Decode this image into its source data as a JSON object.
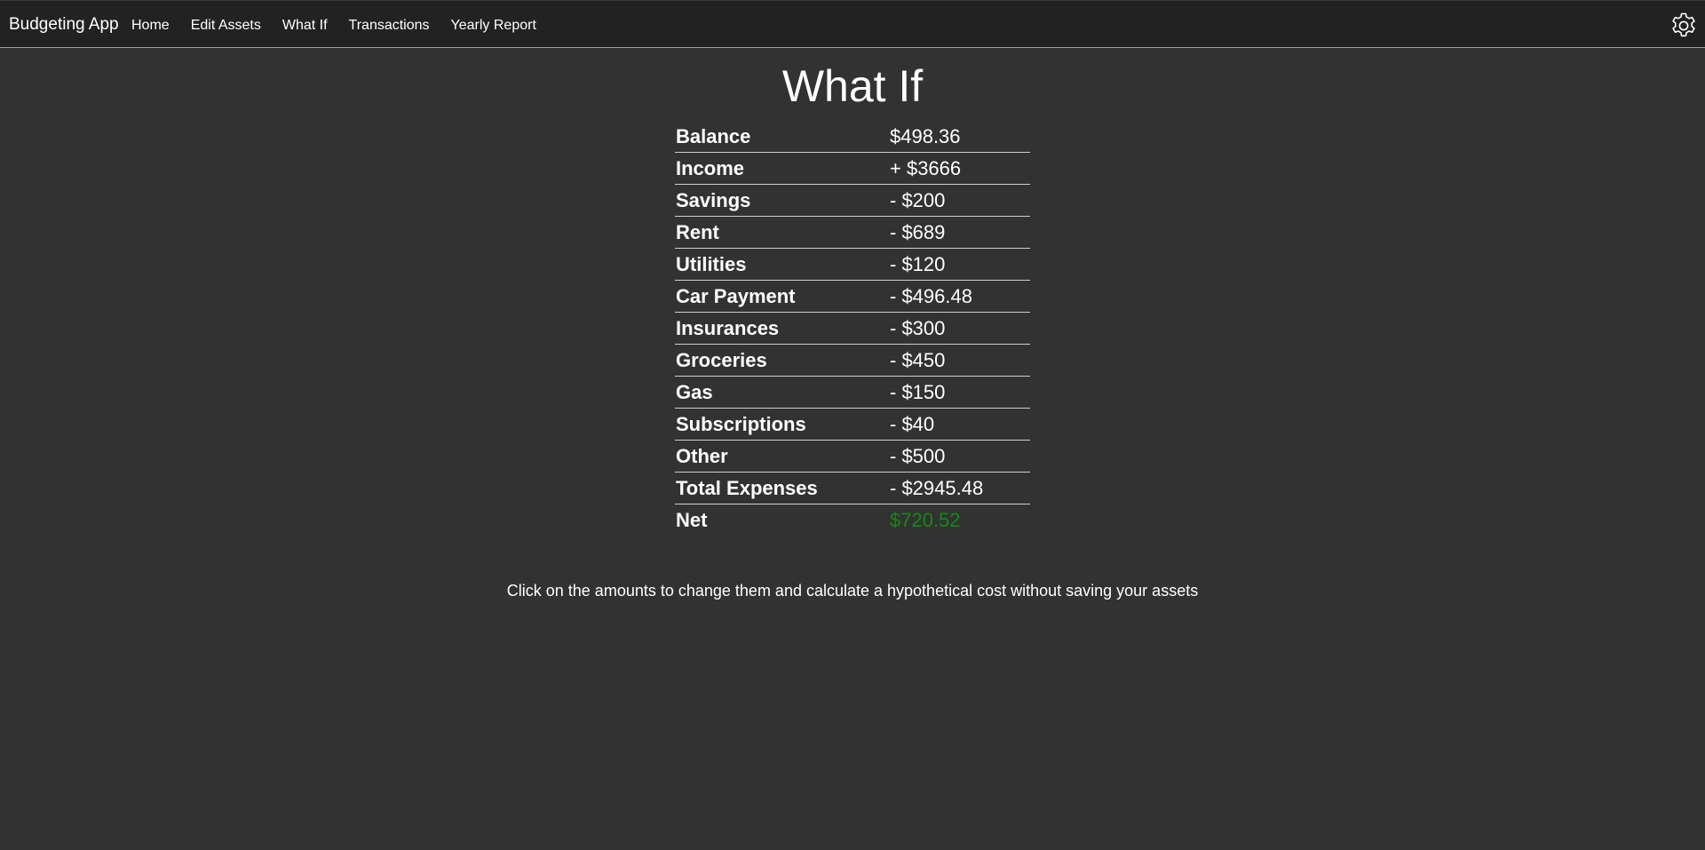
{
  "nav": {
    "brand": "Budgeting App",
    "links": [
      "Home",
      "Edit Assets",
      "What If",
      "Transactions",
      "Yearly Report"
    ],
    "settings_icon": "gear-icon"
  },
  "page": {
    "title": "What If",
    "hint": "Click on the amounts to change them and calculate a hypothetical cost without saving your assets"
  },
  "rows": [
    {
      "label": "Balance",
      "amount": "$498.36"
    },
    {
      "label": "Income",
      "amount": "+ $3666"
    },
    {
      "label": "Savings",
      "amount": "- $200"
    },
    {
      "label": "Rent",
      "amount": "- $689"
    },
    {
      "label": "Utilities",
      "amount": "- $120"
    },
    {
      "label": "Car Payment",
      "amount": "- $496.48"
    },
    {
      "label": "Insurances",
      "amount": "- $300"
    },
    {
      "label": "Groceries",
      "amount": "- $450"
    },
    {
      "label": "Gas",
      "amount": "- $150"
    },
    {
      "label": "Subscriptions",
      "amount": "- $40"
    },
    {
      "label": "Other",
      "amount": "- $500"
    },
    {
      "label": "Total Expenses",
      "amount": "- $2945.48"
    },
    {
      "label": "Net",
      "amount": "$720.52"
    }
  ],
  "colors": {
    "background": "#323232",
    "navbar": "#222222",
    "net_positive": "#138a13"
  }
}
